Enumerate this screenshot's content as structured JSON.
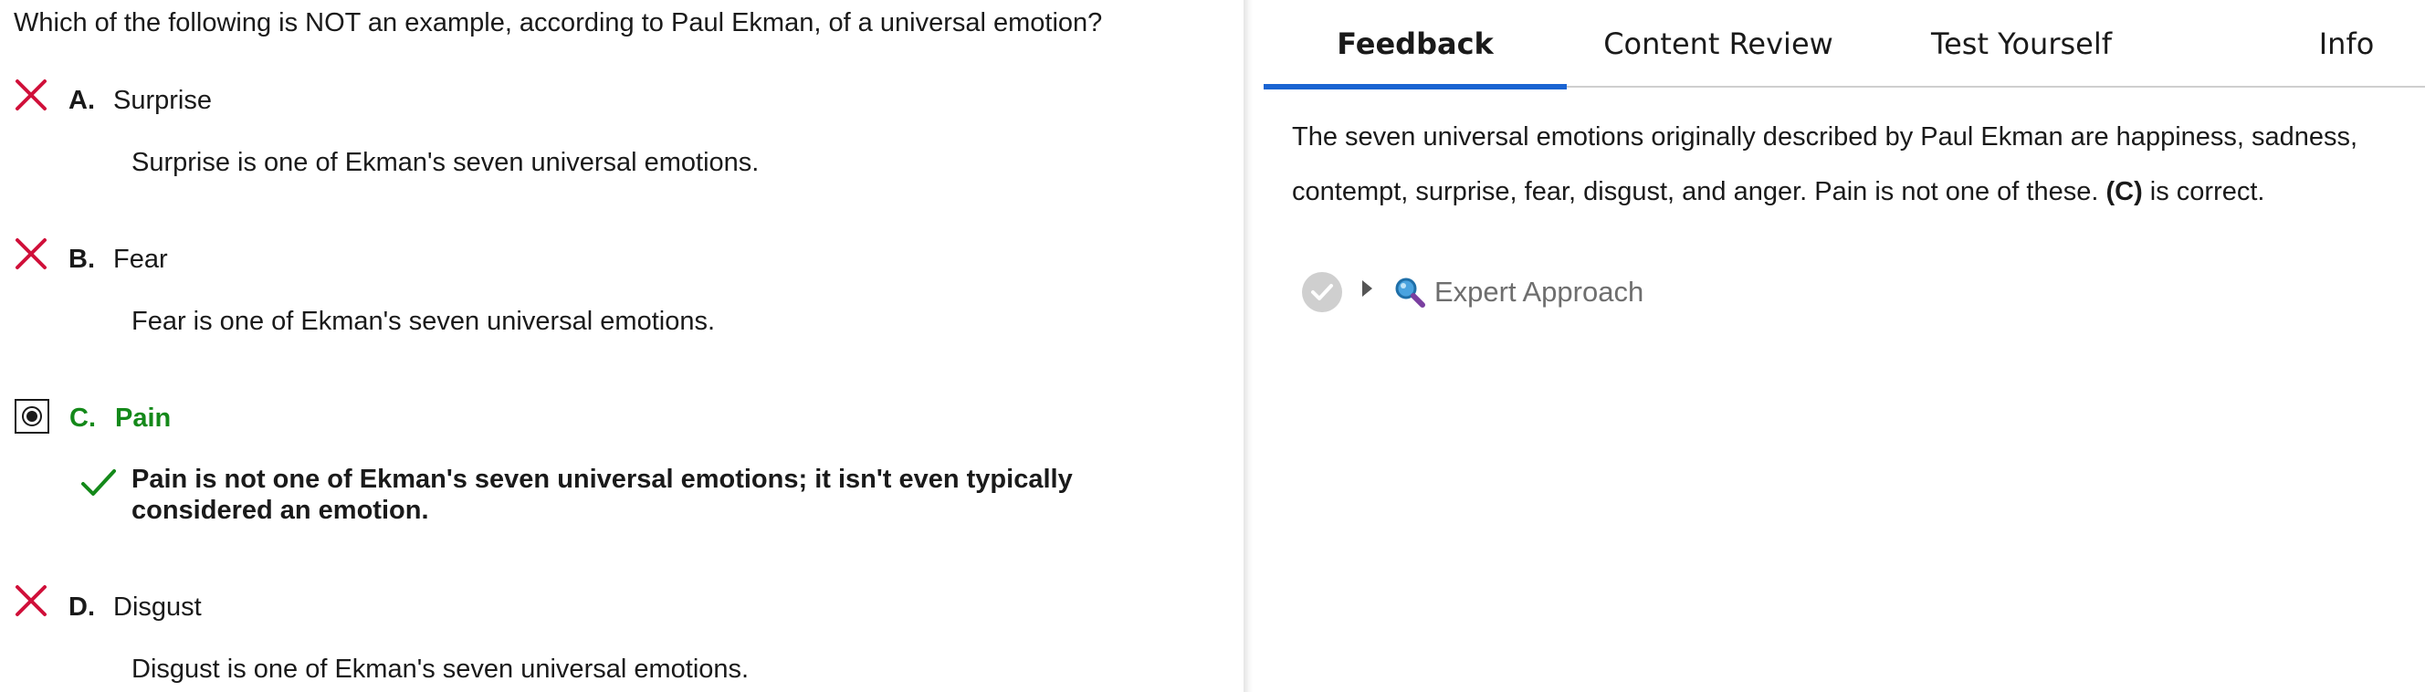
{
  "question": {
    "text": "Which of the following is NOT an example, according to Paul Ekman, of a universal emotion?"
  },
  "choices": [
    {
      "letter": "A.",
      "text": "Surprise",
      "explanation": "Surprise is one of Ekman's seven universal emotions.",
      "status": "incorrect",
      "icon": "x-icon"
    },
    {
      "letter": "B.",
      "text": "Fear",
      "explanation": "Fear is one of Ekman's seven universal emotions.",
      "status": "incorrect",
      "icon": "x-icon"
    },
    {
      "letter": "C.",
      "text": "Pain",
      "explanation": "Pain is not one of Ekman's seven universal emotions; it isn't even typically considered an emotion.",
      "status": "correct",
      "selected": true,
      "icon": "checkmark-icon"
    },
    {
      "letter": "D.",
      "text": "Disgust",
      "explanation": "Disgust is one of Ekman's seven universal emotions.",
      "status": "incorrect",
      "icon": "x-icon"
    }
  ],
  "tabs": [
    {
      "label": "Feedback",
      "active": true
    },
    {
      "label": "Content Review",
      "active": false
    },
    {
      "label": "Test Yourself",
      "active": false
    },
    {
      "label": "Info",
      "active": false
    }
  ],
  "feedback": {
    "body_before": "The seven universal emotions originally described by Paul Ekman are happiness, sadness, contempt, surprise, fear, disgust, and anger. Pain is not one of these. ",
    "answer_ref": "(C)",
    "body_after": " is correct."
  },
  "expert_approach": {
    "label": "Expert Approach"
  },
  "colors": {
    "incorrect": "#d0103a",
    "correct": "#14891a",
    "active_tab": "#1a64d2",
    "muted_text": "#6e6e6e"
  }
}
